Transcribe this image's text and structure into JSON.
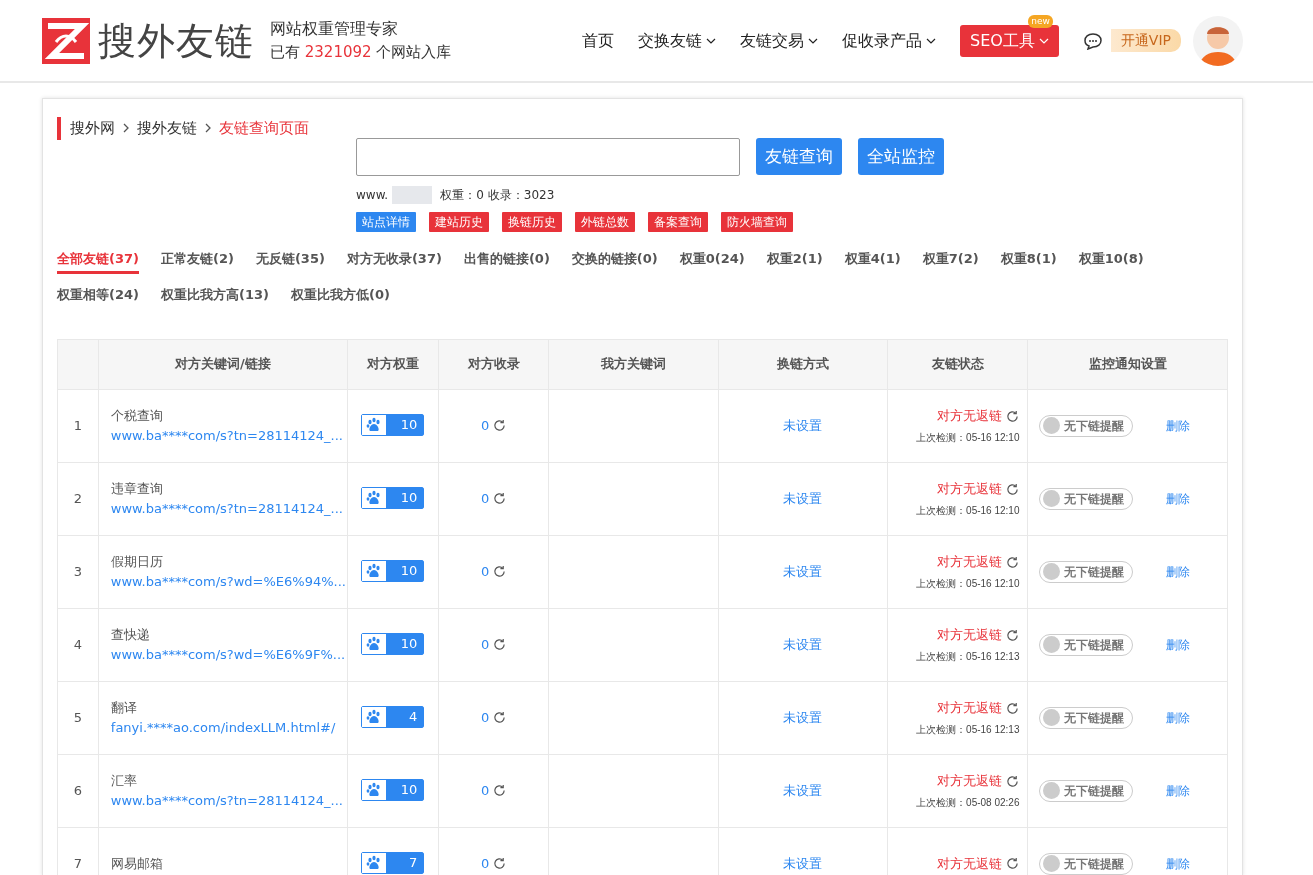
{
  "header": {
    "logo_text": "搜外友链",
    "tagline": "网站权重管理专家",
    "stats_prefix": "已有",
    "stats_count": "2321092",
    "stats_suffix": "个网站入库",
    "nav": [
      {
        "label": "首页",
        "dropdown": false
      },
      {
        "label": "交换友链",
        "dropdown": true
      },
      {
        "label": "友链交易",
        "dropdown": true
      },
      {
        "label": "促收录产品",
        "dropdown": true
      }
    ],
    "seo_button": {
      "label": "SEO工具",
      "badge": "new"
    },
    "vip": "开通VIP"
  },
  "breadcrumb": [
    {
      "label": "搜外网",
      "current": false
    },
    {
      "label": "搜外友链",
      "current": false
    },
    {
      "label": "友链查询页面",
      "current": true
    }
  ],
  "search": {
    "buttons": [
      "友链查询",
      "全站监控"
    ]
  },
  "site_info": {
    "domain": "www.",
    "weight": "权重：0",
    "indexed": "收录：3023"
  },
  "tools": [
    {
      "label": "站点详情",
      "kind": "primary"
    },
    {
      "label": "建站历史",
      "kind": "danger"
    },
    {
      "label": "换链历史",
      "kind": "danger"
    },
    {
      "label": "外链总数",
      "kind": "danger"
    },
    {
      "label": "备案查询",
      "kind": "danger"
    },
    {
      "label": "防火墙查询",
      "kind": "danger"
    }
  ],
  "filters": [
    {
      "label": "全部友链(37)",
      "selected": true
    },
    {
      "label": "正常友链(2)",
      "selected": false
    },
    {
      "label": "无反链(35)",
      "selected": false
    },
    {
      "label": "对方无收录(37)",
      "selected": false
    },
    {
      "label": "出售的链接(0)",
      "selected": false
    },
    {
      "label": "交换的链接(0)",
      "selected": false
    },
    {
      "label": "权重0(24)",
      "selected": false
    },
    {
      "label": "权重2(1)",
      "selected": false
    },
    {
      "label": "权重4(1)",
      "selected": false
    },
    {
      "label": "权重7(2)",
      "selected": false
    },
    {
      "label": "权重8(1)",
      "selected": false
    },
    {
      "label": "权重10(8)",
      "selected": false
    },
    {
      "label": "权重相等(24)",
      "selected": false
    },
    {
      "label": "权重比我方高(13)",
      "selected": false
    },
    {
      "label": "权重比我方低(0)",
      "selected": false
    }
  ],
  "table": {
    "columns": [
      "对方关键词/链接",
      "对方权重",
      "对方收录",
      "我方关键词",
      "换链方式",
      "友链状态",
      "监控通知设置"
    ],
    "rows": [
      {
        "index": "1",
        "keyword": "个税查询",
        "link": "www.ba****com/s?tn=28114124_...",
        "weight": "10",
        "indexed": "0",
        "method": "未设置",
        "status": "对方无返链",
        "checked": "上次检测：05-16 12:10",
        "toggle_label": "无下链提醒",
        "on": false,
        "action": "删除"
      },
      {
        "index": "2",
        "keyword": "违章查询",
        "link": "www.ba****com/s?tn=28114124_...",
        "weight": "10",
        "indexed": "0",
        "method": "未设置",
        "status": "对方无返链",
        "checked": "上次检测：05-16 12:10",
        "toggle_label": "无下链提醒",
        "on": false,
        "action": "删除"
      },
      {
        "index": "3",
        "keyword": "假期日历",
        "link": "www.ba****com/s?wd=%E6%94%...",
        "weight": "10",
        "indexed": "0",
        "method": "未设置",
        "status": "对方无返链",
        "checked": "上次检测：05-16 12:10",
        "toggle_label": "无下链提醒",
        "on": false,
        "action": "删除"
      },
      {
        "index": "4",
        "keyword": "查快递",
        "link": "www.ba****com/s?wd=%E6%9F%...",
        "weight": "10",
        "indexed": "0",
        "method": "未设置",
        "status": "对方无返链",
        "checked": "上次检测：05-16 12:13",
        "toggle_label": "无下链提醒",
        "on": false,
        "action": "删除"
      },
      {
        "index": "5",
        "keyword": "翻译",
        "link": "fanyi.****ao.com/indexLLM.html#/",
        "weight": "4",
        "indexed": "0",
        "method": "未设置",
        "status": "对方无返链",
        "checked": "上次检测：05-16 12:13",
        "toggle_label": "无下链提醒",
        "on": false,
        "action": "删除"
      },
      {
        "index": "6",
        "keyword": "汇率",
        "link": "www.ba****com/s?tn=28114124_...",
        "weight": "10",
        "indexed": "0",
        "method": "未设置",
        "status": "对方无返链",
        "checked": "上次检测：05-08 02:26",
        "toggle_label": "无下链提醒",
        "on": false,
        "action": "删除"
      },
      {
        "index": "7",
        "keyword": "网易邮箱",
        "weight": "7",
        "indexed": "0",
        "method": "未设置",
        "status": "对方无返链",
        "toggle_label": "无下链提醒",
        "on": false,
        "action": "删除"
      }
    ]
  }
}
